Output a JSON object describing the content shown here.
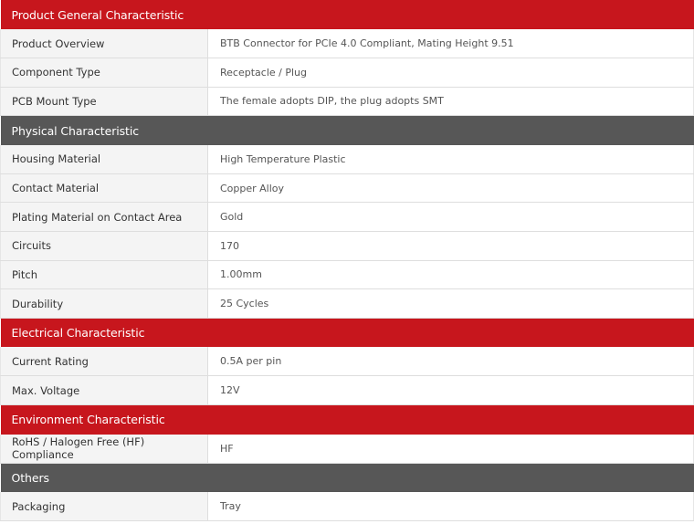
{
  "sections": [
    {
      "title": "Product General Characteristic",
      "color": "#c7161d",
      "rows": [
        {
          "label": "Product Overview",
          "value": "BTB Connector for PCIe 4.0 Compliant, Mating Height 9.51"
        },
        {
          "label": "Component Type",
          "value": "Receptacle / Plug"
        },
        {
          "label": "PCB Mount Type",
          "value": "The female adopts DIP, the plug adopts SMT"
        }
      ]
    },
    {
      "title": "Physical Characteristic",
      "color": "#575757",
      "rows": [
        {
          "label": "Housing Material",
          "value": "High Temperature Plastic"
        },
        {
          "label": "Contact Material",
          "value": "Copper Alloy"
        },
        {
          "label": "Plating Material on Contact Area",
          "value": "Gold"
        },
        {
          "label": "Circuits",
          "value": "170"
        },
        {
          "label": "Pitch",
          "value": "1.00mm"
        },
        {
          "label": "Durability",
          "value": "25 Cycles"
        }
      ]
    },
    {
      "title": "Electrical Characteristic",
      "color": "#c7161d",
      "rows": [
        {
          "label": "Current Rating",
          "value": "0.5A per pin"
        },
        {
          "label": "Max. Voltage",
          "value": "12V"
        }
      ]
    },
    {
      "title": "Environment Characteristic",
      "color": "#c7161d",
      "rows": [
        {
          "label": "RoHS / Halogen Free (HF) Compliance",
          "value": "HF"
        }
      ]
    },
    {
      "title": "Others",
      "color": "#575757",
      "rows": [
        {
          "label": "Packaging",
          "value": "Tray"
        }
      ]
    }
  ]
}
